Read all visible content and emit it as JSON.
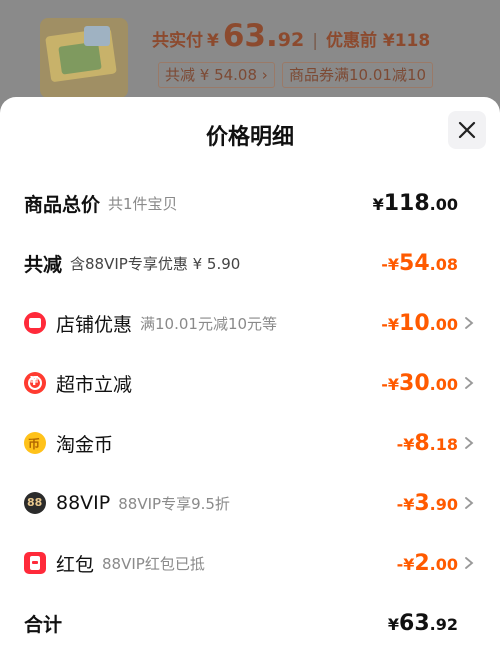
{
  "background": {
    "summary_label": "共实付",
    "summary_currency": "¥",
    "summary_int": "63.",
    "summary_dec": "92",
    "separator": "|",
    "original_label": "优惠前 ¥118",
    "total_discount_pill": "共减 ¥ 54.08 ›",
    "coupon_pill": "商品券满10.01减10"
  },
  "sheet": {
    "title": "价格明细",
    "rows": [
      {
        "label": "商品总价",
        "sub": "共1件宝贝",
        "sym": "¥",
        "int": "118",
        "dec": ".00"
      },
      {
        "label": "共减",
        "sub": "含88VIP专享优惠 ¥ 5.90",
        "sym": "-¥",
        "int": "54",
        "dec": ".08"
      },
      {
        "label": "店铺优惠",
        "sub": "满10.01元减10元等",
        "sym": "-¥",
        "int": "10",
        "dec": ".00"
      },
      {
        "label": "超市立减",
        "sub": "",
        "sym": "-¥",
        "int": "30",
        "dec": ".00"
      },
      {
        "label": "淘金币",
        "sub": "",
        "sym": "-¥",
        "int": "8",
        "dec": ".18"
      },
      {
        "label": "88VIP",
        "sub": "88VIP专享9.5折",
        "sym": "-¥",
        "int": "3",
        "dec": ".90"
      },
      {
        "label": "红包",
        "sub": "88VIP红包已抵",
        "sym": "-¥",
        "int": "2",
        "dec": ".00"
      },
      {
        "label": "合计",
        "sub": "",
        "sym": "¥",
        "int": "63",
        "dec": ".92"
      }
    ]
  },
  "colors": {
    "discount": "#ff5a00",
    "text": "#111111",
    "muted": "#8a8a8a"
  },
  "icons": [
    "shop-icon",
    "market-discount-icon",
    "gold-coin-icon",
    "vip-88-icon",
    "red-packet-icon",
    "chevron-right-icon",
    "close-icon"
  ]
}
